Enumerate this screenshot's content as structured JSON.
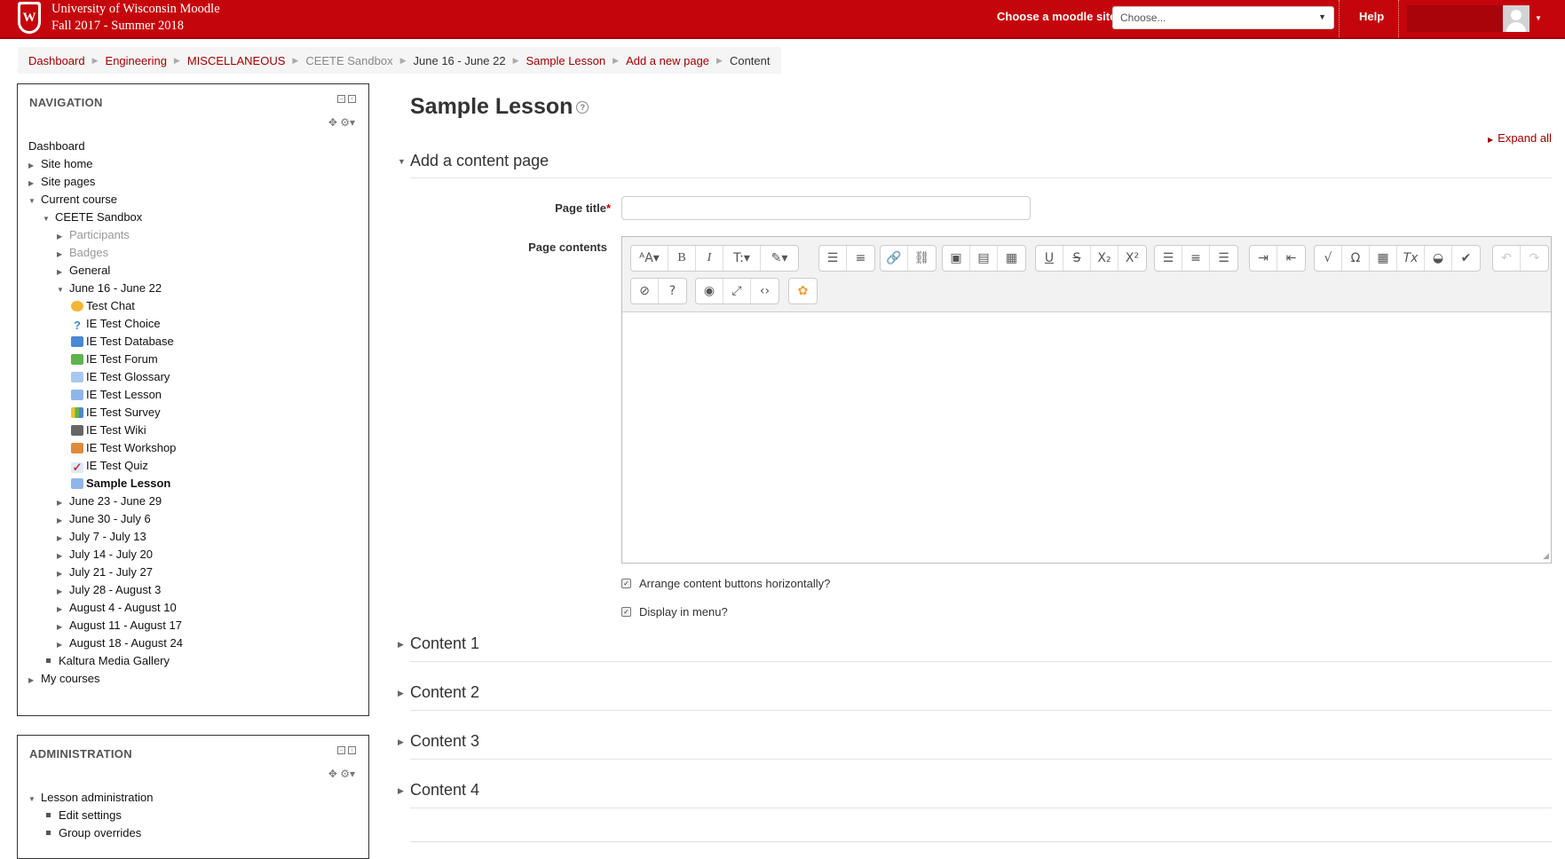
{
  "header": {
    "site_line1": "University of Wisconsin Moodle",
    "site_line2": "Fall 2017 - Summer 2018",
    "crest_letter": "W",
    "choose_label": "Choose a moodle site:",
    "choose_value": "Choose...",
    "help": "Help"
  },
  "breadcrumb": [
    "Dashboard",
    "Engineering",
    "MISCELLANEOUS",
    "CEETE Sandbox",
    "June 16 - June 22",
    "Sample Lesson",
    "Add a new page",
    "Content"
  ],
  "navigation": {
    "title": "NAVIGATION",
    "items": [
      {
        "label": "Dashboard"
      },
      {
        "label": "Site home"
      },
      {
        "label": "Site pages"
      },
      {
        "label": "Current course"
      },
      {
        "label": "CEETE Sandbox"
      },
      {
        "label": "Participants"
      },
      {
        "label": "Badges"
      },
      {
        "label": "General"
      },
      {
        "label": "June 16 - June 22"
      },
      {
        "label": "Test Chat",
        "icon": "chat-icon"
      },
      {
        "label": "IE Test Choice",
        "icon": "choice-icon"
      },
      {
        "label": "IE Test Database",
        "icon": "database-icon"
      },
      {
        "label": "IE Test Forum",
        "icon": "forum-icon"
      },
      {
        "label": "IE Test Glossary",
        "icon": "glossary-icon"
      },
      {
        "label": "IE Test Lesson",
        "icon": "lesson-icon"
      },
      {
        "label": "IE Test Survey",
        "icon": "survey-icon"
      },
      {
        "label": "IE Test Wiki",
        "icon": "wiki-icon"
      },
      {
        "label": "IE Test Workshop",
        "icon": "workshop-icon"
      },
      {
        "label": "IE Test Quiz",
        "icon": "quiz-icon"
      },
      {
        "label": "Sample Lesson",
        "icon": "lesson-icon"
      },
      {
        "label": "June 23 - June 29"
      },
      {
        "label": "June 30 - July 6"
      },
      {
        "label": "July 7 - July 13"
      },
      {
        "label": "July 14 - July 20"
      },
      {
        "label": "July 21 - July 27"
      },
      {
        "label": "July 28 - August 3"
      },
      {
        "label": "August 4 - August 10"
      },
      {
        "label": "August 11 - August 17"
      },
      {
        "label": "August 18 - August 24"
      },
      {
        "label": "Kaltura Media Gallery"
      },
      {
        "label": "My courses"
      }
    ]
  },
  "administration": {
    "title": "ADMINISTRATION",
    "items": [
      {
        "label": "Lesson administration"
      },
      {
        "label": "Edit settings"
      },
      {
        "label": "Group overrides"
      }
    ]
  },
  "main": {
    "title": "Sample Lesson",
    "expand_all": "Expand all",
    "section_title": "Add a content page",
    "page_title_label": "Page title",
    "required_mark": "*",
    "page_title_value": "",
    "page_contents_label": "Page contents",
    "checkbox1": "Arrange content buttons horizontally?",
    "checkbox2": "Display in menu?",
    "content_sections": [
      "Content 1",
      "Content 2",
      "Content 3",
      "Content 4"
    ]
  },
  "colors": {
    "brand": "#c5050c",
    "link": "#a10000"
  }
}
